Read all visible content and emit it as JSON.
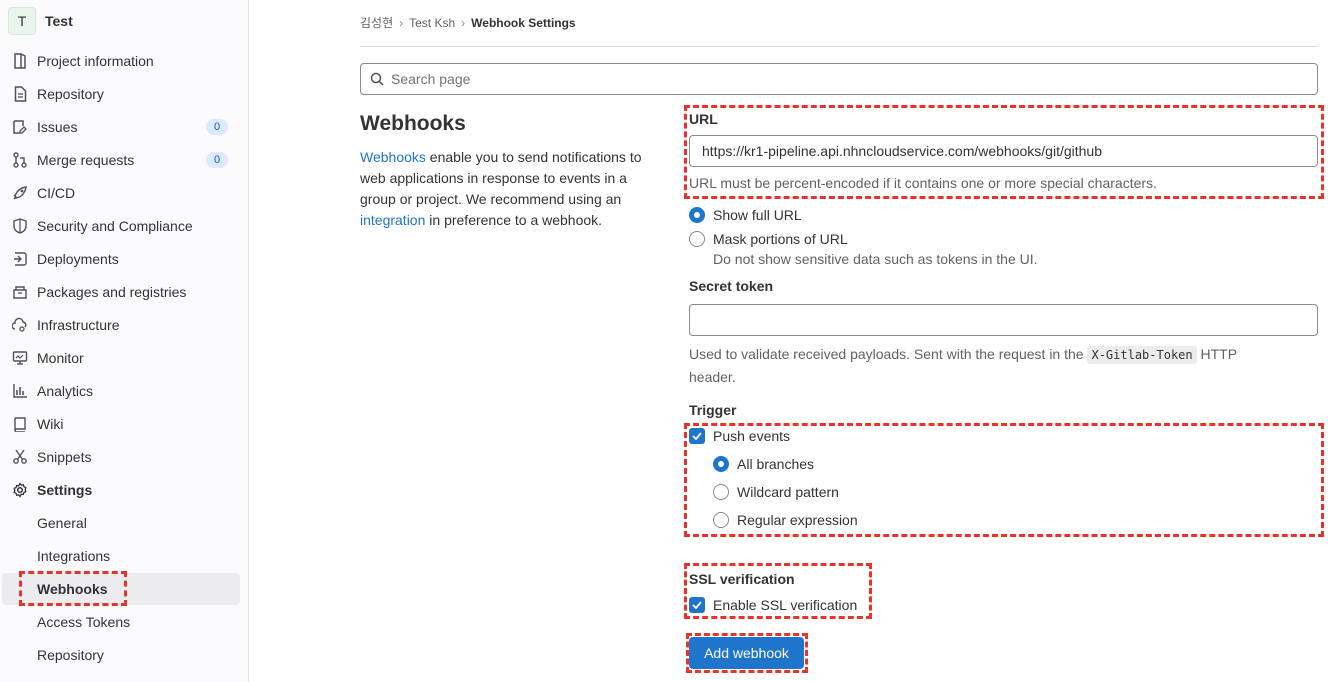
{
  "project": {
    "avatar": "T",
    "name": "Test"
  },
  "sidebar": {
    "items": [
      {
        "label": "Project information",
        "icon": "project-icon"
      },
      {
        "label": "Repository",
        "icon": "document-icon"
      },
      {
        "label": "Issues",
        "icon": "issues-icon",
        "badge": "0"
      },
      {
        "label": "Merge requests",
        "icon": "merge-request-icon",
        "badge": "0"
      },
      {
        "label": "CI/CD",
        "icon": "rocket-icon"
      },
      {
        "label": "Security and Compliance",
        "icon": "shield-icon"
      },
      {
        "label": "Deployments",
        "icon": "deployments-icon"
      },
      {
        "label": "Packages and registries",
        "icon": "package-icon"
      },
      {
        "label": "Infrastructure",
        "icon": "cloud-gear-icon"
      },
      {
        "label": "Monitor",
        "icon": "monitor-icon"
      },
      {
        "label": "Analytics",
        "icon": "chart-icon"
      },
      {
        "label": "Wiki",
        "icon": "book-icon"
      },
      {
        "label": "Snippets",
        "icon": "scissors-icon"
      },
      {
        "label": "Settings",
        "icon": "settings-icon"
      }
    ],
    "sub_items": [
      {
        "label": "General"
      },
      {
        "label": "Integrations"
      },
      {
        "label": "Webhooks",
        "active": true
      },
      {
        "label": "Access Tokens"
      },
      {
        "label": "Repository"
      }
    ]
  },
  "breadcrumb": [
    "김성현",
    "Test Ksh",
    "Webhook Settings"
  ],
  "search": {
    "placeholder": "Search page"
  },
  "intro": {
    "title": "Webhooks",
    "link1": "Webhooks",
    "text1": " enable you to send notifications to web applications in response to events in a group or project. We recommend using an ",
    "link2": "integration",
    "text2": " in preference to a webhook."
  },
  "form": {
    "url_label": "URL",
    "url_value": "https://kr1-pipeline.api.nhncloudservice.com/webhooks/git/github",
    "url_help": "URL must be percent-encoded if it contains one or more special characters.",
    "show_full_url": "Show full URL",
    "mask_url": "Mask portions of URL",
    "mask_help": "Do not show sensitive data such as tokens in the UI.",
    "secret_label": "Secret token",
    "secret_value": "",
    "secret_help_1": "Used to validate received payloads. Sent with the request in the",
    "secret_help_code": "X-Gitlab-Token",
    "secret_help_2": "HTTP",
    "secret_help_3": "header.",
    "trigger_label": "Trigger",
    "push_events": "Push events",
    "all_branches": "All branches",
    "wildcard": "Wildcard pattern",
    "regex": "Regular expression",
    "ssl_label": "SSL verification",
    "ssl_enable": "Enable SSL verification",
    "submit": "Add webhook"
  },
  "colors": {
    "accent": "#1f75cb",
    "highlight": "#e8332a"
  }
}
